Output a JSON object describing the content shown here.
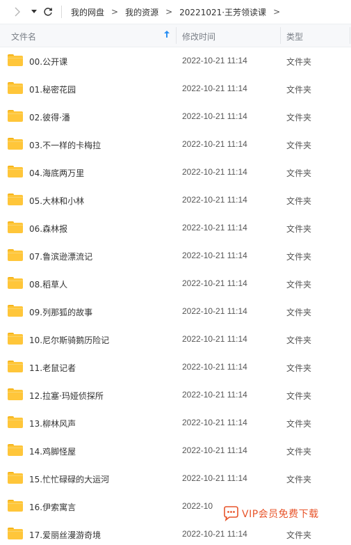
{
  "toolbar": {
    "breadcrumbs": [
      "我的网盘",
      "我的资源",
      "20221021·王芳领读课"
    ],
    "separator": ">"
  },
  "table": {
    "columns": {
      "name": "文件名",
      "time": "修改时间",
      "type": "类型"
    },
    "rows": [
      {
        "name": "00.公开课",
        "time": "2022-10-21 11:14",
        "type": "文件夹"
      },
      {
        "name": "01.秘密花园",
        "time": "2022-10-21 11:14",
        "type": "文件夹"
      },
      {
        "name": "02.彼得·潘",
        "time": "2022-10-21 11:14",
        "type": "文件夹"
      },
      {
        "name": "03.不一样的卡梅拉",
        "time": "2022-10-21 11:14",
        "type": "文件夹"
      },
      {
        "name": "04.海底两万里",
        "time": "2022-10-21 11:14",
        "type": "文件夹"
      },
      {
        "name": "05.大林和小林",
        "time": "2022-10-21 11:14",
        "type": "文件夹"
      },
      {
        "name": "06.森林报",
        "time": "2022-10-21 11:14",
        "type": "文件夹"
      },
      {
        "name": "07.鲁滨逊漂流记",
        "time": "2022-10-21 11:14",
        "type": "文件夹"
      },
      {
        "name": "08.稻草人",
        "time": "2022-10-21 11:14",
        "type": "文件夹"
      },
      {
        "name": "09.列那狐的故事",
        "time": "2022-10-21 11:14",
        "type": "文件夹"
      },
      {
        "name": "10.尼尔斯骑鹅历险记",
        "time": "2022-10-21 11:14",
        "type": "文件夹"
      },
      {
        "name": "11.老鼠记者",
        "time": "2022-10-21 11:14",
        "type": "文件夹"
      },
      {
        "name": "12.拉塞·玛娅侦探所",
        "time": "2022-10-21 11:14",
        "type": "文件夹"
      },
      {
        "name": "13.柳林风声",
        "time": "2022-10-21 11:14",
        "type": "文件夹"
      },
      {
        "name": "14.鸡脚怪屋",
        "time": "2022-10-21 11:14",
        "type": "文件夹"
      },
      {
        "name": "15.忙忙碌碌的大运河",
        "time": "2022-10-21 11:14",
        "type": "文件夹"
      },
      {
        "name": "16.伊索寓言",
        "time": "2022-10",
        "type": ""
      },
      {
        "name": "17.爱丽丝漫游奇境",
        "time": "2022-10-21 11:14",
        "type": "文件夹"
      }
    ]
  },
  "overlay": {
    "vip_text": "VIP会员免费下载"
  },
  "colors": {
    "accent": "#2b8ff2",
    "folder": "#ffc63a",
    "vip": "#e8542a"
  }
}
